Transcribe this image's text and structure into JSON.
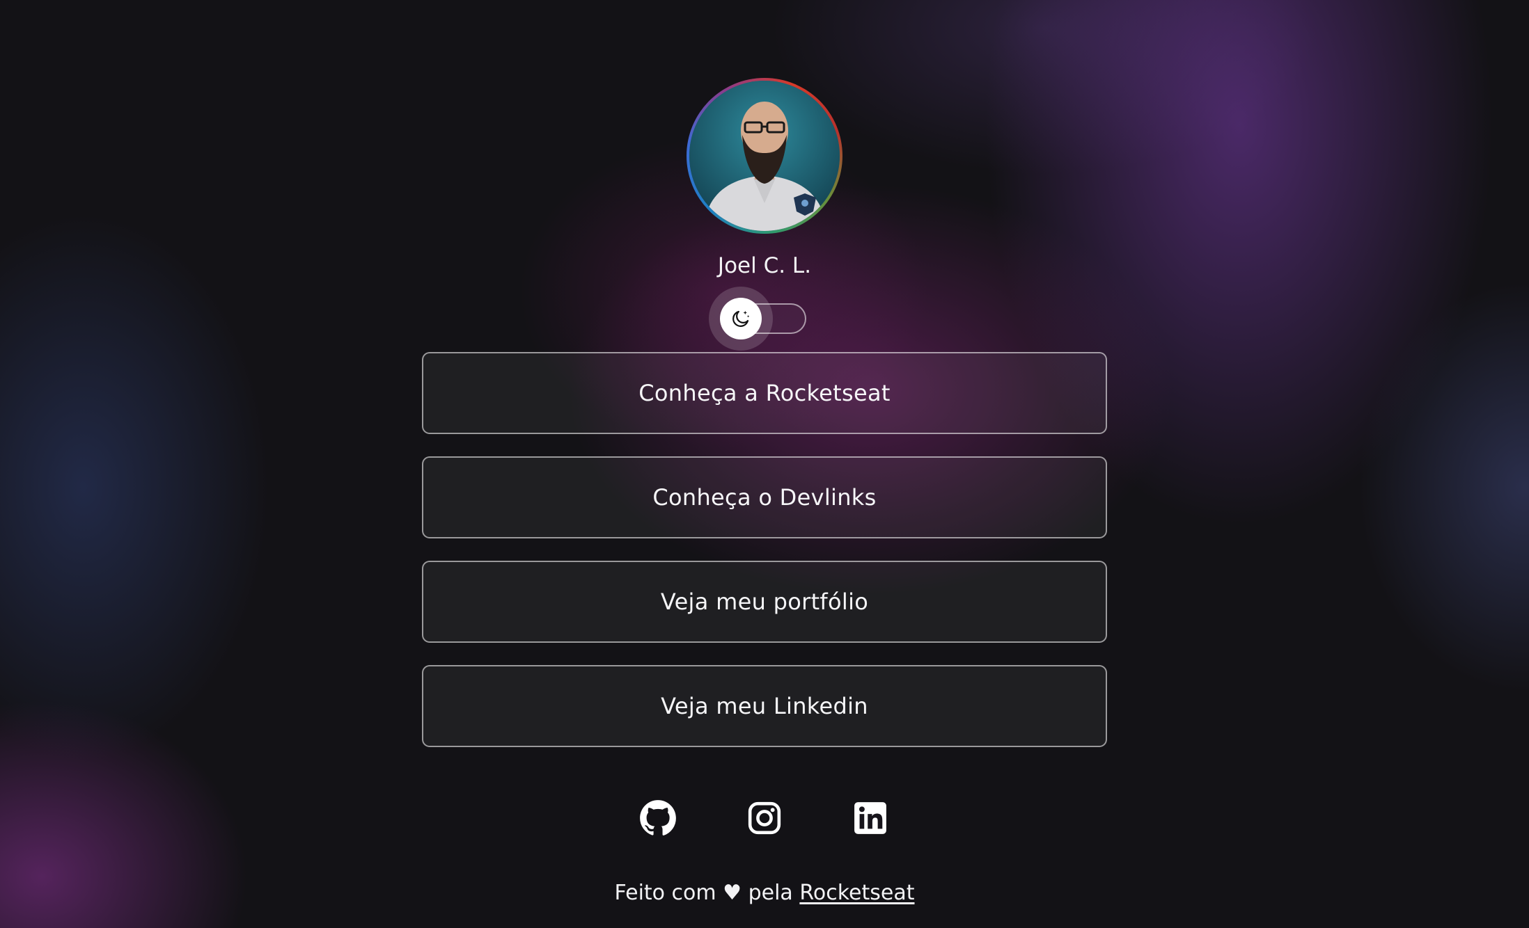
{
  "profile": {
    "name": "Joel C. L."
  },
  "theme_switch": {
    "icon": "moon-stars-icon",
    "state": "dark"
  },
  "links": [
    {
      "label": "Conheça a Rocketseat"
    },
    {
      "label": "Conheça o Devlinks"
    },
    {
      "label": "Veja meu portfólio"
    },
    {
      "label": "Veja meu Linkedin"
    }
  ],
  "socials": [
    {
      "icon": "github-icon"
    },
    {
      "icon": "instagram-icon"
    },
    {
      "icon": "linkedin-icon"
    }
  ],
  "footer": {
    "text": "Feito com ♥ pela",
    "link_label": "Rocketseat"
  },
  "colors": {
    "text": "#f3f3f5",
    "background": "#131216",
    "accent_purple": "#7a3ca8",
    "accent_magenta": "#7a2370"
  }
}
